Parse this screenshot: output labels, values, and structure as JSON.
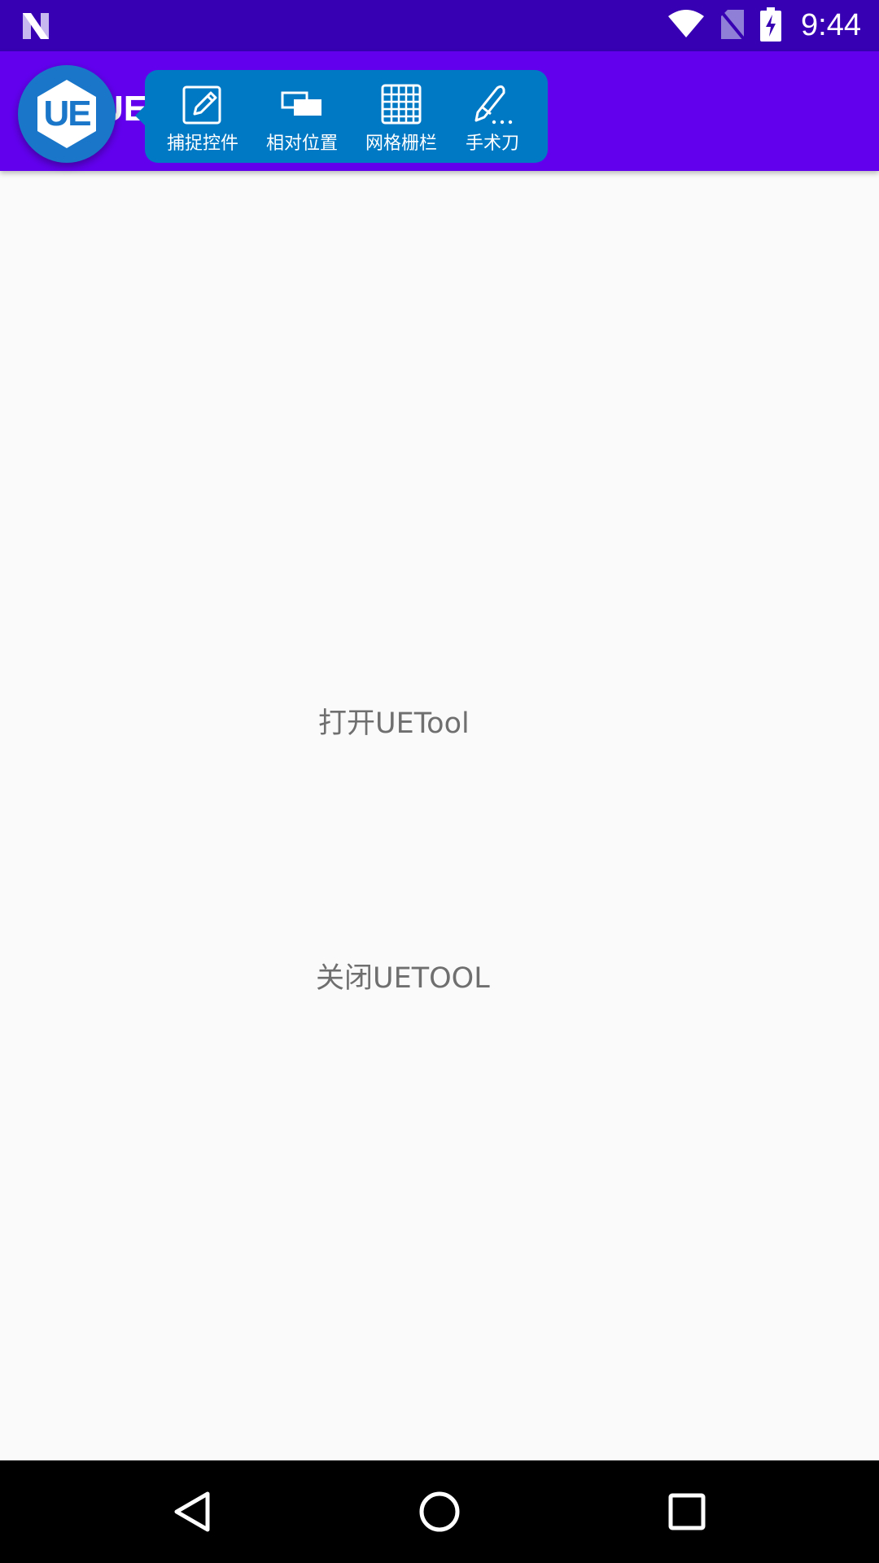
{
  "status_bar": {
    "time": "9:44",
    "icons": [
      "notification-n-icon",
      "wifi-icon",
      "no-sim-icon",
      "battery-charging-icon"
    ]
  },
  "app_bar": {
    "title": "UETool",
    "background": "#6200ee"
  },
  "floating_button": {
    "label": "UE",
    "color": "#1976c9"
  },
  "menu": {
    "background": "#0079c4",
    "items": [
      {
        "label": "捕捉控件",
        "icon": "edit-pencil-icon"
      },
      {
        "label": "相对位置",
        "icon": "overlap-rectangles-icon"
      },
      {
        "label": "网格栅栏",
        "icon": "grid-icon"
      },
      {
        "label": "手术刀",
        "icon": "scalpel-icon"
      }
    ]
  },
  "main": {
    "open_button": "打开UETool",
    "close_button": "关闭UETOOL"
  },
  "nav_bar": {
    "buttons": [
      "back-icon",
      "home-icon",
      "recents-icon"
    ]
  }
}
